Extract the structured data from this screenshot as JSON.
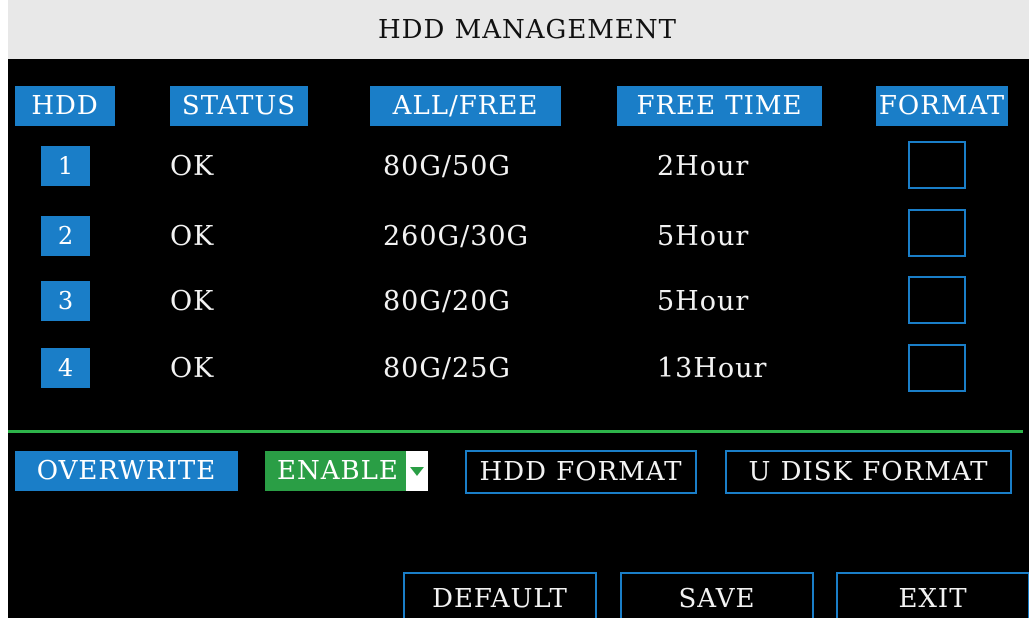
{
  "title": "HDD MANAGEMENT",
  "columns": {
    "hdd": "HDD",
    "status": "STATUS",
    "all_free": "ALL/FREE",
    "free_time": "FREE TIME",
    "format": "FORMAT"
  },
  "rows": [
    {
      "num": "1",
      "status": "OK",
      "all_free": "80G/50G",
      "free_time": "2Hour",
      "format_checked": false
    },
    {
      "num": "2",
      "status": "OK",
      "all_free": "260G/30G",
      "free_time": "5Hour",
      "format_checked": false
    },
    {
      "num": "3",
      "status": "OK",
      "all_free": "80G/20G",
      "free_time": "5Hour",
      "format_checked": false
    },
    {
      "num": "4",
      "status": "OK",
      "all_free": "80G/25G",
      "free_time": "13Hour",
      "format_checked": false
    }
  ],
  "overwrite": {
    "label": "OVERWRITE",
    "value": "ENABLE"
  },
  "buttons": {
    "hdd_format": "HDD FORMAT",
    "u_disk_format": "U DISK FORMAT",
    "default": "DEFAULT",
    "save": "SAVE",
    "exit": "EXIT"
  },
  "colors": {
    "background": "#000000",
    "title_bar": "#e8e8e8",
    "accent_blue": "#1a7ec8",
    "accent_green": "#2a9e45",
    "divider_green": "#2db34a"
  },
  "icons": {
    "dropdown": "chevron-down-icon"
  }
}
